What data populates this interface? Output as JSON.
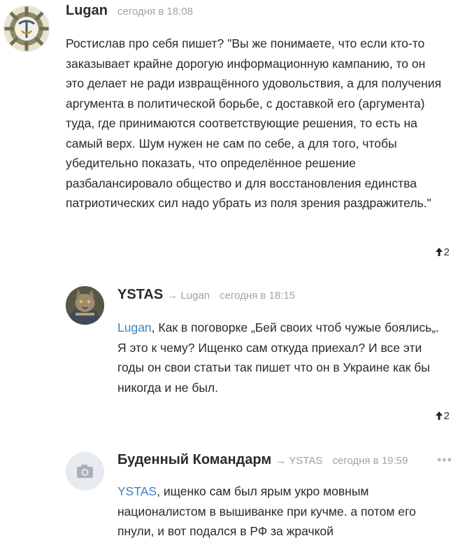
{
  "comments": [
    {
      "author": "Lugan",
      "reply_to": "",
      "time": "сегодня в 18:08",
      "text": "Ростислав про себя пишет? \"Вы же понимаете, что если кто-то заказывает крайне дорогую информационную кампанию, то он это делает не ради извращённого удовольствия, а для получения аргумента в политической борьбе, с доставкой его (аргумента) туда, где принимаются соответствующие решения, то есть на самый верх. Шум нужен не сам по себе, а для того, чтобы убедительно показать, что определённое решение разбалансировало общество и для восстановления единства патриотических сил надо убрать из поля зрения раздражитель.\"",
      "votes": "2"
    },
    {
      "author": "YSTAS",
      "reply_to": "→ Lugan",
      "time": "сегодня в 18:15",
      "mention": "Lugan",
      "text": ", Как в поговорке „Бей своих чтоб чужые боялись„. Я это к чему? Ищенко сам откуда приехал? И все эти годы он свои статьи так пишет что он в Украине как бы никогда и не был.",
      "votes": "2"
    },
    {
      "author": "Буденный Командарм",
      "reply_to": "→ YSTAS",
      "time": "сегодня в 19:59",
      "mention": "YSTAS",
      "text": ", ищенко сам был ярым укро мовным националистом в вышиванке при кучме. а потом его пнули, и вот подался в РФ за жрачкой",
      "more": "•••"
    }
  ],
  "colors": {
    "mention": "#3b82c4",
    "meta": "#a0a4a8"
  }
}
